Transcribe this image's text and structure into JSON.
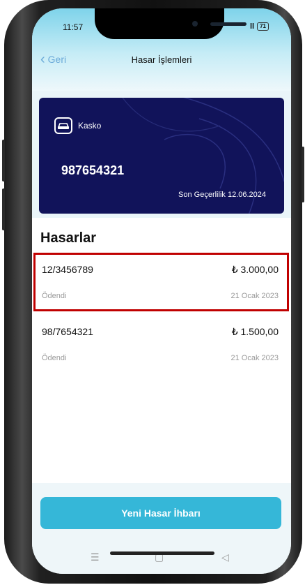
{
  "status_bar": {
    "time": "11:57",
    "signal": "ll",
    "battery": "71"
  },
  "nav": {
    "back_label": "Geri",
    "title": "Hasar İşlemleri"
  },
  "card": {
    "type": "Kasko",
    "policy_number": "987654321",
    "expiry": "Son Geçerlilik 12.06.2024"
  },
  "claims": {
    "title": "Hasarlar",
    "items": [
      {
        "number": "12/3456789",
        "amount": "₺ 3.000,00",
        "status": "Ödendi",
        "date": "21 Ocak 2023"
      },
      {
        "number": "98/7654321",
        "amount": "₺ 1.500,00",
        "status": "Ödendi",
        "date": "21 Ocak 2023"
      }
    ]
  },
  "actions": {
    "new_claim_label": "Yeni Hasar İhbarı"
  },
  "system_nav": {
    "menu": "☰",
    "home": "▢",
    "back": "◁"
  },
  "colors": {
    "accent": "#35b7d8",
    "card_bg": "#11135a",
    "highlight": "#c00000"
  }
}
